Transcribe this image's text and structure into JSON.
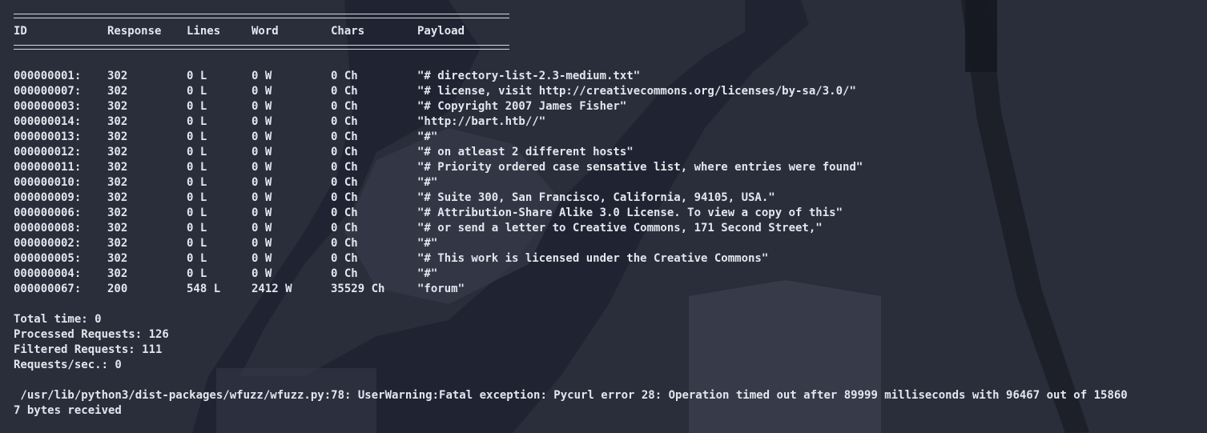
{
  "header": {
    "id": "ID",
    "response": "Response",
    "lines": "Lines",
    "word": "Word",
    "chars": "Chars",
    "payload": "Payload"
  },
  "rows": [
    {
      "id": "000000001:",
      "response": "302",
      "lines": "0 L",
      "word": "0 W",
      "chars": "0 Ch",
      "payload": "\"# directory-list-2.3-medium.txt\""
    },
    {
      "id": "000000007:",
      "response": "302",
      "lines": "0 L",
      "word": "0 W",
      "chars": "0 Ch",
      "payload": "\"# license, visit http://creativecommons.org/licenses/by-sa/3.0/\""
    },
    {
      "id": "000000003:",
      "response": "302",
      "lines": "0 L",
      "word": "0 W",
      "chars": "0 Ch",
      "payload": "\"# Copyright 2007 James Fisher\""
    },
    {
      "id": "000000014:",
      "response": "302",
      "lines": "0 L",
      "word": "0 W",
      "chars": "0 Ch",
      "payload": "\"http://bart.htb//\""
    },
    {
      "id": "000000013:",
      "response": "302",
      "lines": "0 L",
      "word": "0 W",
      "chars": "0 Ch",
      "payload": "\"#\""
    },
    {
      "id": "000000012:",
      "response": "302",
      "lines": "0 L",
      "word": "0 W",
      "chars": "0 Ch",
      "payload": "\"# on atleast 2 different hosts\""
    },
    {
      "id": "000000011:",
      "response": "302",
      "lines": "0 L",
      "word": "0 W",
      "chars": "0 Ch",
      "payload": "\"# Priority ordered case sensative list, where entries were found\""
    },
    {
      "id": "000000010:",
      "response": "302",
      "lines": "0 L",
      "word": "0 W",
      "chars": "0 Ch",
      "payload": "\"#\""
    },
    {
      "id": "000000009:",
      "response": "302",
      "lines": "0 L",
      "word": "0 W",
      "chars": "0 Ch",
      "payload": "\"# Suite 300, San Francisco, California, 94105, USA.\""
    },
    {
      "id": "000000006:",
      "response": "302",
      "lines": "0 L",
      "word": "0 W",
      "chars": "0 Ch",
      "payload": "\"# Attribution-Share Alike 3.0 License. To view a copy of this\""
    },
    {
      "id": "000000008:",
      "response": "302",
      "lines": "0 L",
      "word": "0 W",
      "chars": "0 Ch",
      "payload": "\"# or send a letter to Creative Commons, 171 Second Street,\""
    },
    {
      "id": "000000002:",
      "response": "302",
      "lines": "0 L",
      "word": "0 W",
      "chars": "0 Ch",
      "payload": "\"#\""
    },
    {
      "id": "000000005:",
      "response": "302",
      "lines": "0 L",
      "word": "0 W",
      "chars": "0 Ch",
      "payload": "\"# This work is licensed under the Creative Commons\""
    },
    {
      "id": "000000004:",
      "response": "302",
      "lines": "0 L",
      "word": "0 W",
      "chars": "0 Ch",
      "payload": "\"#\""
    },
    {
      "id": "000000067:",
      "response": "200",
      "lines": "548 L",
      "word": "2412 W",
      "chars": "35529 Ch",
      "payload": "\"forum\""
    }
  ],
  "summary": {
    "total_time": "Total time: 0",
    "processed": "Processed Requests: 126",
    "filtered": "Filtered Requests: 111",
    "rate": "Requests/sec.: 0"
  },
  "error": {
    "line1": " /usr/lib/python3/dist-packages/wfuzz/wfuzz.py:78: UserWarning:Fatal exception: Pycurl error 28: Operation timed out after 89999 milliseconds with 96467 out of 15860",
    "line2": "7 bytes received"
  },
  "colors": {
    "background": "#2a2d3a",
    "text": "#e4e6ee"
  }
}
